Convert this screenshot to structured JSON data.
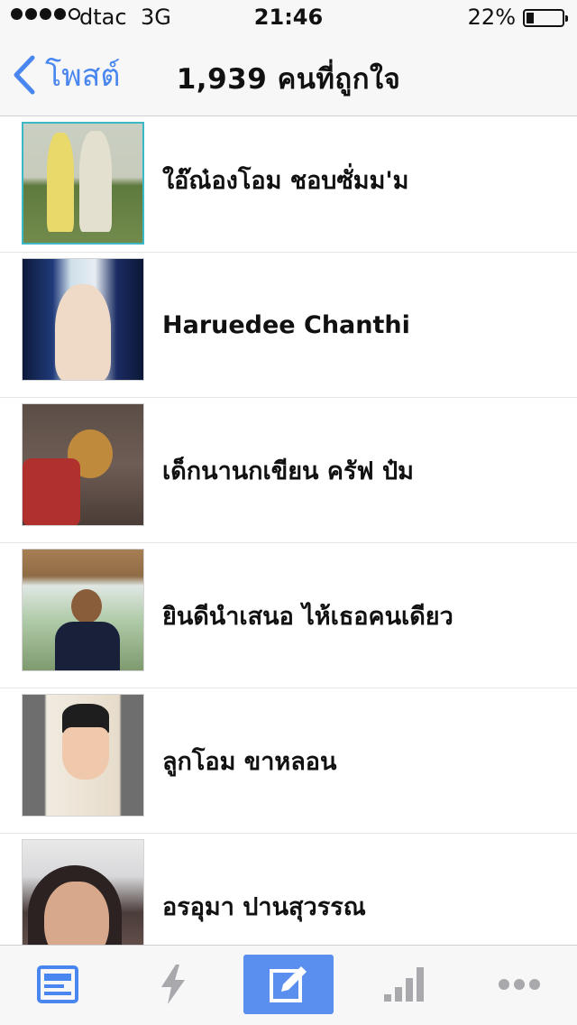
{
  "status_bar": {
    "carrier": "dtac",
    "network": "3G",
    "time": "21:46",
    "battery_percent": "22%",
    "battery_level": 0.22,
    "signal_bars_filled": 4,
    "signal_bars_total": 5
  },
  "nav": {
    "back_label": "โพสต์",
    "title": "1,939 คนที่ถูกใจ"
  },
  "people": [
    {
      "name": "ใอ๊ณ๋องโอม ชอบซั่มม'ม"
    },
    {
      "name": "Haruedee Chanthi"
    },
    {
      "name": "เด็กนานกเขียน ครัฟ ป๋ม"
    },
    {
      "name": "ยินดีนำเสนอ ไห้เธอคนเดียว"
    },
    {
      "name": "ลูกโอม ขาหลอน"
    },
    {
      "name": "อรอุมา ปานสุวรรณ"
    }
  ],
  "tabbar": {
    "items": [
      {
        "icon": "news-feed-icon",
        "active": false,
        "color": "#4a86ef"
      },
      {
        "icon": "lightning-icon",
        "active": false,
        "color": "#a8a8ad"
      },
      {
        "icon": "compose-icon",
        "active": true,
        "color": "#ffffff"
      },
      {
        "icon": "stats-bars-icon",
        "active": false,
        "color": "#a8a8ad"
      },
      {
        "icon": "more-dots-icon",
        "active": false,
        "color": "#a8a8ad"
      }
    ]
  },
  "colors": {
    "accent": "#4a86ef",
    "active_tab_bg": "#5a8ff0"
  }
}
